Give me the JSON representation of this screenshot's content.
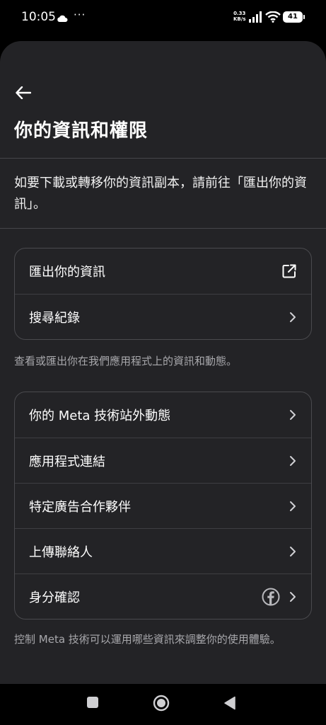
{
  "status_bar": {
    "time": "10:05",
    "dots": "···",
    "speed_value": "0.33",
    "speed_unit": "KB/s",
    "battery": "41"
  },
  "header": {
    "title": "你的資訊和權限"
  },
  "intro": {
    "text": "如要下載或轉移你的資訊副本，請前往「匯出你的資訊」。"
  },
  "card1": {
    "items": [
      {
        "label": "匯出你的資訊",
        "icon": "external-link-icon"
      },
      {
        "label": "搜尋紀錄",
        "icon": "chevron-right-icon"
      }
    ],
    "caption": "查看或匯出你在我們應用程式上的資訊和動態。"
  },
  "card2": {
    "items": [
      {
        "label": "你的 Meta 技術站外動態",
        "icon": "chevron-right-icon"
      },
      {
        "label": "應用程式連結",
        "icon": "chevron-right-icon"
      },
      {
        "label": "特定廣告合作夥伴",
        "icon": "chevron-right-icon"
      },
      {
        "label": "上傳聯絡人",
        "icon": "chevron-right-icon"
      },
      {
        "label": "身分確認",
        "icon": "chevron-right-icon",
        "extra_icon": "facebook-icon"
      }
    ],
    "caption": "控制 Meta 技術可以運用哪些資訊來調整你的使用體驗。"
  },
  "colors": {
    "background": "#232326",
    "text": "#ffffff",
    "muted_text": "#a8a8ac",
    "border": "#4a4a4e"
  }
}
